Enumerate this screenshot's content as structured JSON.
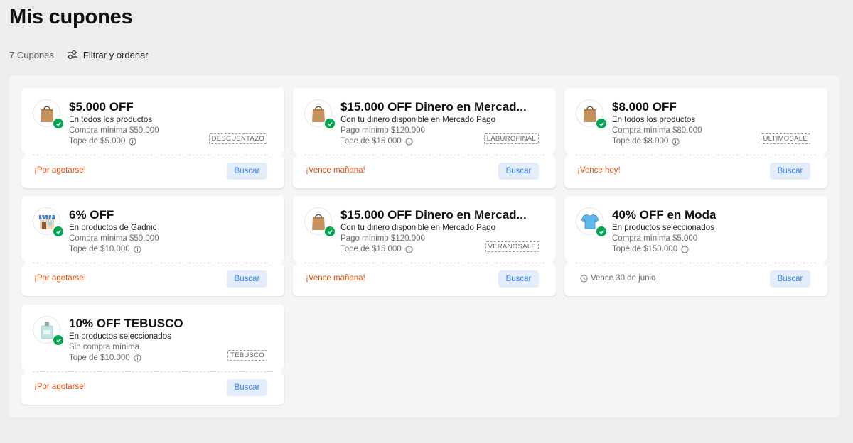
{
  "page": {
    "title": "Mis cupones",
    "count_label": "7 Cupones",
    "filter_label": "Filtrar y ordenar"
  },
  "coupons": [
    {
      "title": "$5.000 OFF",
      "desc": "En todos los productos",
      "min": "Compra mínima $50.000",
      "cap": "Tope de $5.000",
      "code": "DESCUENTAZO",
      "status": "¡Por agotarse!",
      "button": "Buscar",
      "icon": "shopping-bag-icon"
    },
    {
      "title": "$15.000 OFF Dinero en Mercad...",
      "desc": "Con tu dinero disponible en Mercado Pago",
      "min": "Pago mínimo $120.000",
      "cap": "Tope de $15.000",
      "code": "LABUROFINAL",
      "status": "¡Vence mañana!",
      "button": "Buscar",
      "icon": "shopping-bag-icon"
    },
    {
      "title": "$8.000 OFF",
      "desc": "En todos los productos",
      "min": "Compra mínima $80.000",
      "cap": "Tope de $8.000",
      "code": "ULTIMOSALE",
      "status": "¡Vence hoy!",
      "button": "Buscar",
      "icon": "shopping-bag-icon"
    },
    {
      "title": "6% OFF",
      "desc": "En productos de Gadnic",
      "min": "Compra mínima $50.000",
      "cap": "Tope de $10.000",
      "code": "",
      "status": "¡Por agotarse!",
      "button": "Buscar",
      "icon": "store-icon"
    },
    {
      "title": "$15.000 OFF Dinero en Mercad...",
      "desc": "Con tu dinero disponible en Mercado Pago",
      "min": "Pago mínimo $120.000",
      "cap": "Tope de $15.000",
      "code": "VERANOSALE",
      "status": "¡Vence mañana!",
      "button": "Buscar",
      "icon": "shopping-bag-icon"
    },
    {
      "title": "40% OFF en Moda",
      "desc": "En productos seleccionados",
      "min": "Compra mínima $5.000",
      "cap": "Tope de $150.000",
      "code": "",
      "status": "Vence 30 de junio",
      "button": "Buscar",
      "icon": "tshirt-icon"
    },
    {
      "title": "10% OFF TEBUSCO",
      "desc": "En productos seleccionados",
      "min": "Sin compra mínima.",
      "cap": "Tope de $10.000",
      "code": "TEBUSCO",
      "status": "¡Por agotarse!",
      "button": "Buscar",
      "icon": "perfume-icon"
    }
  ],
  "colors": {
    "accent": "#3483fa",
    "button_bg": "#e3edfb",
    "urgent": "#e14d09",
    "check": "#00a650"
  }
}
